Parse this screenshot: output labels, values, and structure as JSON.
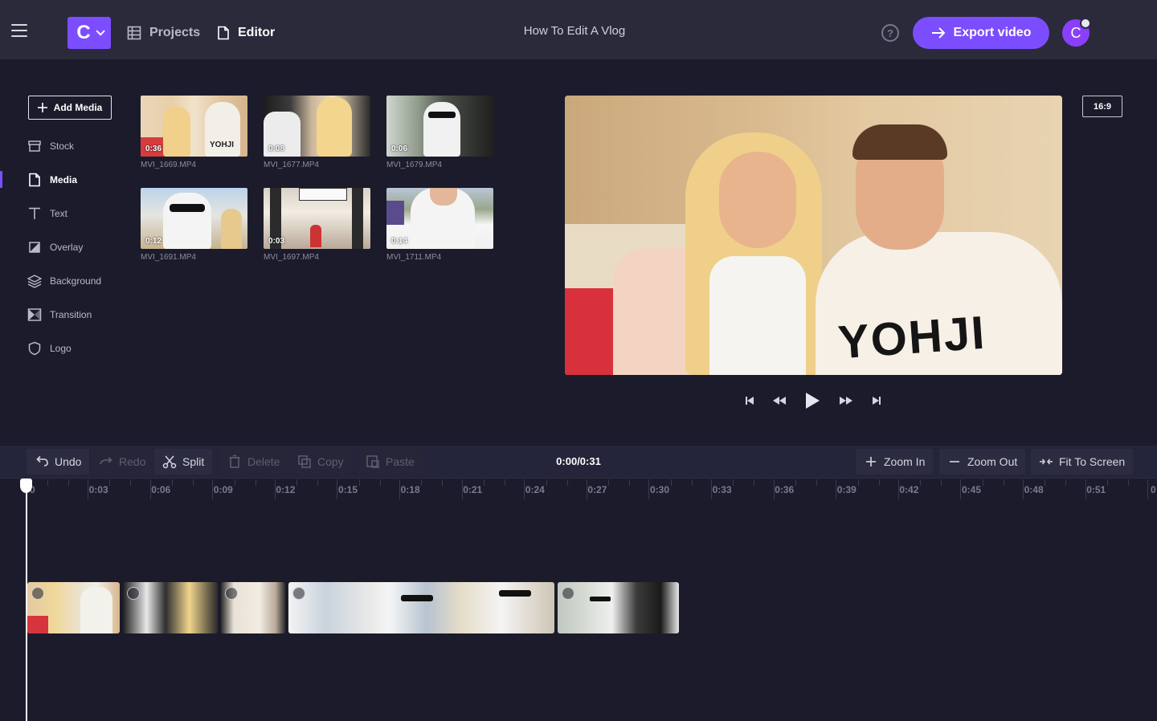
{
  "header": {
    "brand_letter": "C",
    "nav_projects": "Projects",
    "nav_editor": "Editor",
    "project_title": "How To Edit A Vlog",
    "help_glyph": "?",
    "export_label": "Export video",
    "avatar_letter": "C"
  },
  "sidebar": {
    "add_media": "Add Media",
    "items": [
      {
        "label": "Stock",
        "icon": "stock-icon"
      },
      {
        "label": "Media",
        "icon": "media-icon"
      },
      {
        "label": "Text",
        "icon": "text-icon"
      },
      {
        "label": "Overlay",
        "icon": "overlay-icon"
      },
      {
        "label": "Background",
        "icon": "layers-icon"
      },
      {
        "label": "Transition",
        "icon": "transition-icon"
      },
      {
        "label": "Logo",
        "icon": "shield-icon"
      }
    ]
  },
  "media": [
    {
      "name": "MVI_1669.MP4",
      "duration": "0:36"
    },
    {
      "name": "MVI_1677.MP4",
      "duration": "0:08"
    },
    {
      "name": "MVI_1679.MP4",
      "duration": "0:06"
    },
    {
      "name": "MVI_1691.MP4",
      "duration": "0:12"
    },
    {
      "name": "MVI_1697.MP4",
      "duration": "0:03"
    },
    {
      "name": "MVI_1711.MP4",
      "duration": "0:14"
    }
  ],
  "preview": {
    "ratio": "16:9",
    "shirt_text": "YOHJI"
  },
  "toolbar": {
    "undo": "Undo",
    "redo": "Redo",
    "split": "Split",
    "delete": "Delete",
    "copy": "Copy",
    "paste": "Paste",
    "timecode": "0:00/0:31",
    "zoom_in": "Zoom In",
    "zoom_out": "Zoom Out",
    "fit": "Fit To Screen"
  },
  "ruler": {
    "labels": [
      "0",
      "0:03",
      "0:06",
      "0:09",
      "0:12",
      "0:15",
      "0:18",
      "0:21",
      "0:24",
      "0:27",
      "0:30",
      "0:33",
      "0:36",
      "0:39",
      "0:42",
      "0:45",
      "0:48",
      "0:51",
      "0"
    ]
  },
  "timeline": {
    "clip_count": 5
  }
}
